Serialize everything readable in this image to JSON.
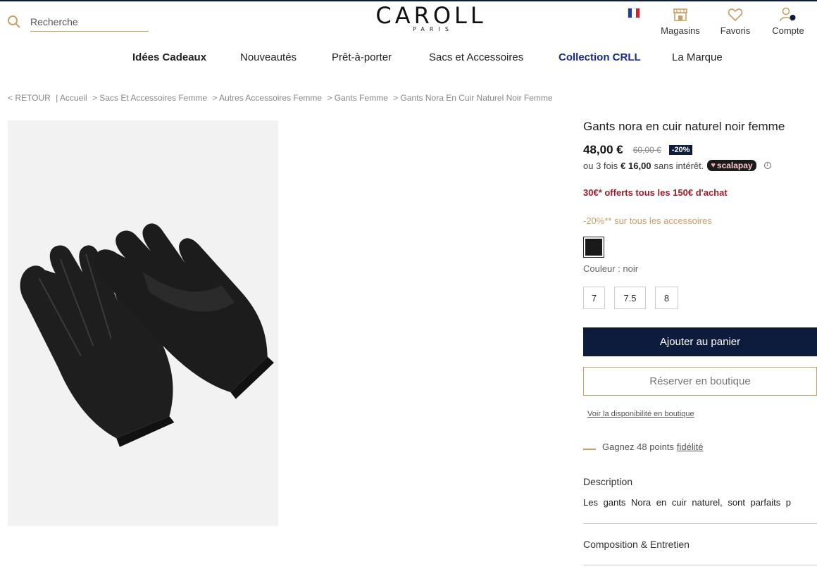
{
  "header": {
    "search_placeholder": "Recherche",
    "logo": "CAROLL",
    "logo_sub": "PARIS",
    "flag": "fr-flag-icon",
    "stores_label": "Magasins",
    "favorites_label": "Favoris",
    "account_label": "Compte"
  },
  "nav": {
    "items": [
      "Idées Cadeaux",
      "Nouveautés",
      "Prêt-à-porter",
      "Sacs et Accessoires",
      "Collection CRLL",
      "La Marque"
    ]
  },
  "breadcrumb": {
    "back": "< RETOUR",
    "items": [
      "| Accueil",
      "> Sacs Et Accessoires Femme",
      "> Autres Accessoires Femme",
      "> Gants Femme",
      "> Gants Nora En Cuir Naturel Noir Femme"
    ]
  },
  "product": {
    "title": "Gants nora en cuir naturel noir femme",
    "price": "48,00 €",
    "old_price": "60,00 €",
    "discount": "-20%",
    "installments_prefix": "ou 3 fois",
    "installments_amount": "€ 16,00",
    "installments_suffix": "sans intérêt.",
    "scalapay": "scalapay",
    "info_icon": "i",
    "promo_offer": "30€* offerts tous les 150€ d'achat",
    "promo_accessories": "-20%** sur tous les accessoires",
    "color_label": "Couleur : noir",
    "sizes": [
      "7",
      "7.5",
      "8"
    ],
    "add_to_cart": "Ajouter au panier",
    "reserve": "Réserver en boutique",
    "availability_link": "Voir la disponibilité en boutique",
    "loyalty_text": "Gagnez 48 points",
    "loyalty_link": "fidélité",
    "description_title": "Description",
    "description_text": "Les gants Nora en cuir naturel, sont parfaits p",
    "composition_title": "Composition & Entretien"
  },
  "colors": {
    "navy": "#0d1b3d",
    "gold": "#c9a063",
    "promo_red": "#9d1c2a",
    "crll_blue": "#1a2a8a"
  }
}
